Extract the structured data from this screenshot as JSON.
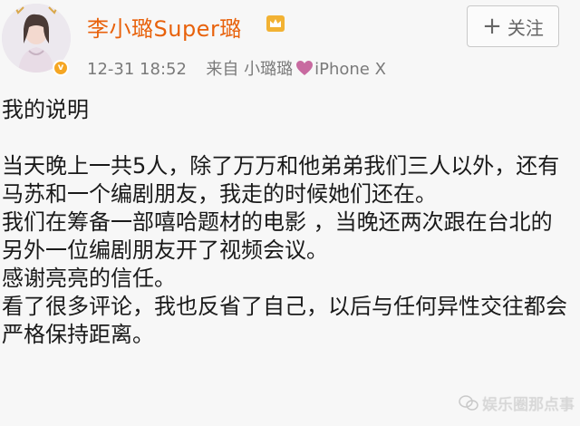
{
  "post": {
    "username": "李小璐Super璐",
    "date": "12-31",
    "time": "18:52",
    "source_prefix": "来自",
    "source_name": "小璐璐",
    "source_device": "iPhone X",
    "follow_label": "关注"
  },
  "content": {
    "title": "我的说明",
    "paragraphs": [
      "当天晚上一共5人，除了万万和他弟弟我们三人以外，还有马苏和一个编剧朋友，我走的时候她们还在。",
      "我们在筹备一部嘻哈题材的电影 ，当晚还两次跟在台北的另外一位编剧朋友开了视频会议。",
      "感谢亮亮的信任。",
      "看了很多评论，我也反省了自己，以后与任何异性交往都会严格保持距离。"
    ]
  },
  "watermark": {
    "text": "娱乐圈那点事"
  },
  "colors": {
    "username": "#e8620c",
    "meta": "#7a7a7a",
    "badge": "#f5a623",
    "heart": "#c86aa0"
  }
}
